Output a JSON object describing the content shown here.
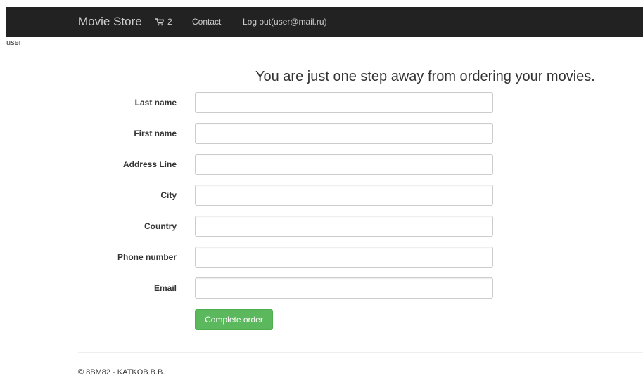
{
  "navbar": {
    "brand": "Movie Store",
    "cart_count": "2",
    "cart_icon": "shopping-cart-icon",
    "contact": "Contact",
    "logout": "Log out(user@mail.ru)"
  },
  "user_label": "user",
  "heading": "You are just one step away from ordering your movies.",
  "form": {
    "fields": [
      {
        "label": "Last name",
        "value": "",
        "placeholder": ""
      },
      {
        "label": "First name",
        "value": "",
        "placeholder": ""
      },
      {
        "label": "Address Line",
        "value": "",
        "placeholder": ""
      },
      {
        "label": "City",
        "value": "",
        "placeholder": ""
      },
      {
        "label": "Country",
        "value": "",
        "placeholder": ""
      },
      {
        "label": "Phone number",
        "value": "",
        "placeholder": ""
      },
      {
        "label": "Email",
        "value": "",
        "placeholder": ""
      }
    ],
    "submit": "Complete order"
  },
  "footer": {
    "text": "© 8BM82 - KATKOB B.B."
  },
  "colors": {
    "navbar_bg": "#222222",
    "nav_text": "#cccccc",
    "button_bg": "#5cb85c"
  }
}
